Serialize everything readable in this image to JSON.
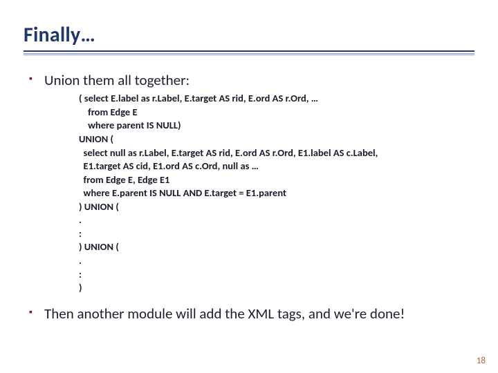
{
  "title": "Finally…",
  "bullets": {
    "first": "Union them all together:",
    "second": "Then another module will add the XML tags, and we're done!"
  },
  "code": "( select E.label as r.Label, E.target AS rid, E.ord AS r.Ord, …\n    from Edge E\n    where parent IS NULL)\nUNION (\n  select null as r.Label, E.target AS rid, E.ord AS r.Ord, E1.label AS c.Label,\n  E1.target AS cid, E1.ord AS c.Ord, null as …\n  from Edge E, Edge E1\n  where E.parent IS NULL AND E.target = E1.parent\n) UNION (\n.\n:\n) UNION (\n.\n:\n)",
  "page_number": "18"
}
